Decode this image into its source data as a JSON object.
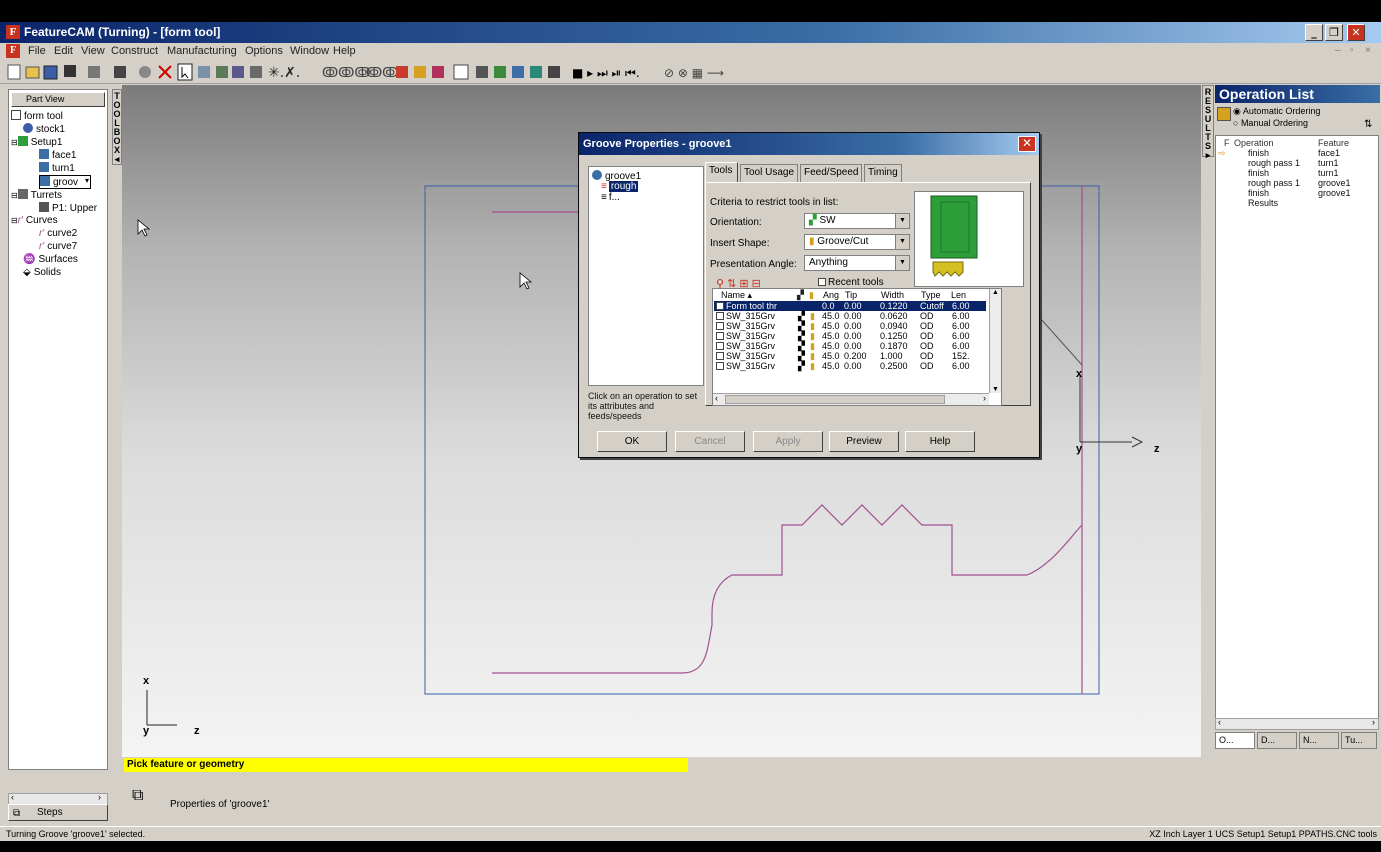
{
  "app": {
    "title": "FeatureCAM (Turning) - [form tool]",
    "icon": "featurecam-icon"
  },
  "menu": [
    "File",
    "Edit",
    "View",
    "Construct",
    "Manufacturing",
    "Options",
    "Window",
    "Help"
  ],
  "left_panel": {
    "part_view_label": "Part View",
    "toolbox_tab": "TOOLBOX",
    "tree": [
      {
        "label": "form tool",
        "level": 0
      },
      {
        "label": "stock1",
        "level": 1
      },
      {
        "label": "Setup1",
        "level": 0
      },
      {
        "label": "face1",
        "level": 2
      },
      {
        "label": "turn1",
        "level": 2
      },
      {
        "label": "groov",
        "level": 2
      },
      {
        "label": "Turrets",
        "level": 0
      },
      {
        "label": "P1: Upper",
        "level": 2
      },
      {
        "label": "Curves",
        "level": 0
      },
      {
        "label": "curve2",
        "level": 2
      },
      {
        "label": "curve7",
        "level": 2
      },
      {
        "label": "Surfaces",
        "level": 1
      },
      {
        "label": "Solids",
        "level": 1
      }
    ],
    "steps_label": "Steps"
  },
  "canvas": {
    "axis_x": "x",
    "axis_y": "y",
    "axis_z": "z"
  },
  "right_panel": {
    "results_tab": "RESULTS",
    "header": "Operation List",
    "ordering_auto": "Automatic Ordering",
    "ordering_manual": "Manual Ordering",
    "col_op_flag": "F",
    "col_operation": "Operation",
    "col_feature": "Feature",
    "rows": [
      {
        "operation": "finish",
        "feature": "face1"
      },
      {
        "operation": "rough pass 1",
        "feature": "turn1"
      },
      {
        "operation": "finish",
        "feature": "turn1"
      },
      {
        "operation": "rough pass 1",
        "feature": "groove1"
      },
      {
        "operation": "finish",
        "feature": "groove1"
      },
      {
        "operation": "Results",
        "feature": ""
      }
    ],
    "tabs": [
      "O...",
      "D...",
      "N...",
      "Tu..."
    ]
  },
  "prompt": {
    "text": "Pick feature or geometry",
    "properties": "Properties of 'groove1'"
  },
  "status": {
    "left": "Turning Groove 'groove1' selected.",
    "right": "XZ  Inch  Layer 1  UCS Setup1  Setup1  PPATHS.CNC  tools"
  },
  "dialog": {
    "title": "Groove Properties - groove1",
    "tree": {
      "root": "groove1",
      "child1": "rough",
      "child2": "f..."
    },
    "hint": "Click on an operation to set its attributes and feeds/speeds",
    "tabs": [
      "Tools",
      "Tool Usage",
      "Feed/Speed",
      "Timing"
    ],
    "criteria_label": "Criteria to restrict tools in list:",
    "orientation_label": "Orientation:",
    "orientation_value": "SW",
    "insert_shape_label": "Insert Shape:",
    "insert_shape_value": "Groove/Cut",
    "presentation_label": "Presentation Angle:",
    "presentation_value": "Anything",
    "recent_tools_label": "Recent tools",
    "table_headers": [
      "Name",
      "Ang",
      "Tip",
      "Width",
      "Type",
      "Len"
    ],
    "tool_rows": [
      {
        "name": "Form tool thr",
        "ang": "0.0",
        "tip": "0.00",
        "width": "0.1220",
        "type": "Cutoff",
        "len": "6.00",
        "selected": true
      },
      {
        "name": "SW_315Grv",
        "ang": "45.0",
        "tip": "0.00",
        "width": "0.0620",
        "type": "OD",
        "len": "6.00",
        "selected": false
      },
      {
        "name": "SW_315Grv",
        "ang": "45.0",
        "tip": "0.00",
        "width": "0.0940",
        "type": "OD",
        "len": "6.00",
        "selected": false
      },
      {
        "name": "SW_315Grv",
        "ang": "45.0",
        "tip": "0.00",
        "width": "0.1250",
        "type": "OD",
        "len": "6.00",
        "selected": false
      },
      {
        "name": "SW_315Grv",
        "ang": "45.0",
        "tip": "0.00",
        "width": "0.1870",
        "type": "OD",
        "len": "6.00",
        "selected": false
      },
      {
        "name": "SW_315Grv",
        "ang": "45.0",
        "tip": "0.200",
        "width": "1.000",
        "type": "OD",
        "len": "152.",
        "selected": false
      },
      {
        "name": "SW_315Grv",
        "ang": "45.0",
        "tip": "0.00",
        "width": "0.2500",
        "type": "OD",
        "len": "6.00",
        "selected": false
      }
    ],
    "buttons": {
      "ok": "OK",
      "cancel": "Cancel",
      "apply": "Apply",
      "preview": "Preview",
      "help": "Help"
    }
  },
  "colors": {
    "title_blue": "#0a246a",
    "selection_blue": "#0a246a",
    "prompt_yellow": "#ffff00",
    "curve_purple": "#a05090",
    "tool_green": "#2e9e3a"
  }
}
